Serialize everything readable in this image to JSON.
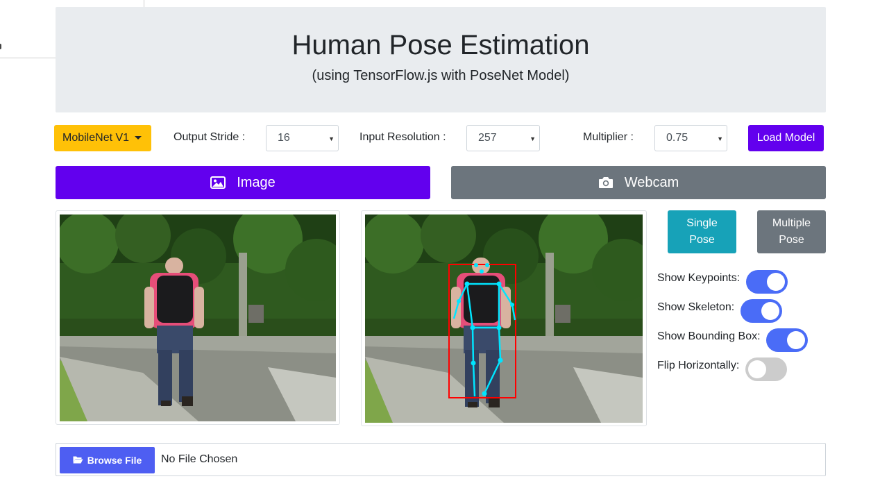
{
  "hero": {
    "title": "Human Pose Estimation",
    "subtitle": "(using TensorFlow.js with PoseNet Model)"
  },
  "controls": {
    "model_label": "MobileNet V1",
    "output_stride_label": "Output Stride :",
    "output_stride_value": "16",
    "input_resolution_label": "Input Resolution :",
    "input_resolution_value": "257",
    "multiplier_label": "Multiplier :",
    "multiplier_value": "0.75",
    "load_label": "Load Model"
  },
  "modes": {
    "image_label": "Image",
    "webcam_label": "Webcam"
  },
  "pose": {
    "single_line1": "Single",
    "single_line2": "Pose",
    "multi_line1": "Multiple",
    "multi_line2": "Pose"
  },
  "options": [
    {
      "label": "Show Keypoints:",
      "enabled": true
    },
    {
      "label": "Show Skeleton:",
      "enabled": true
    },
    {
      "label": "Show Bounding Box:",
      "enabled": true
    },
    {
      "label": "Flip Horizontally:",
      "enabled": false
    }
  ],
  "file": {
    "browse_label": "Browse File",
    "status": "No File Chosen"
  },
  "colors": {
    "primary": "#6200ee",
    "warning": "#ffc107",
    "info": "#17a2b8",
    "secondary": "#6c757d",
    "toggle_on": "#4a6cf7",
    "skeleton": "#00e5ff",
    "bbox": "#ff0000"
  },
  "icons": {
    "image_mode": "image-icon",
    "webcam_mode": "camera-icon",
    "browse": "folder-open-icon"
  }
}
